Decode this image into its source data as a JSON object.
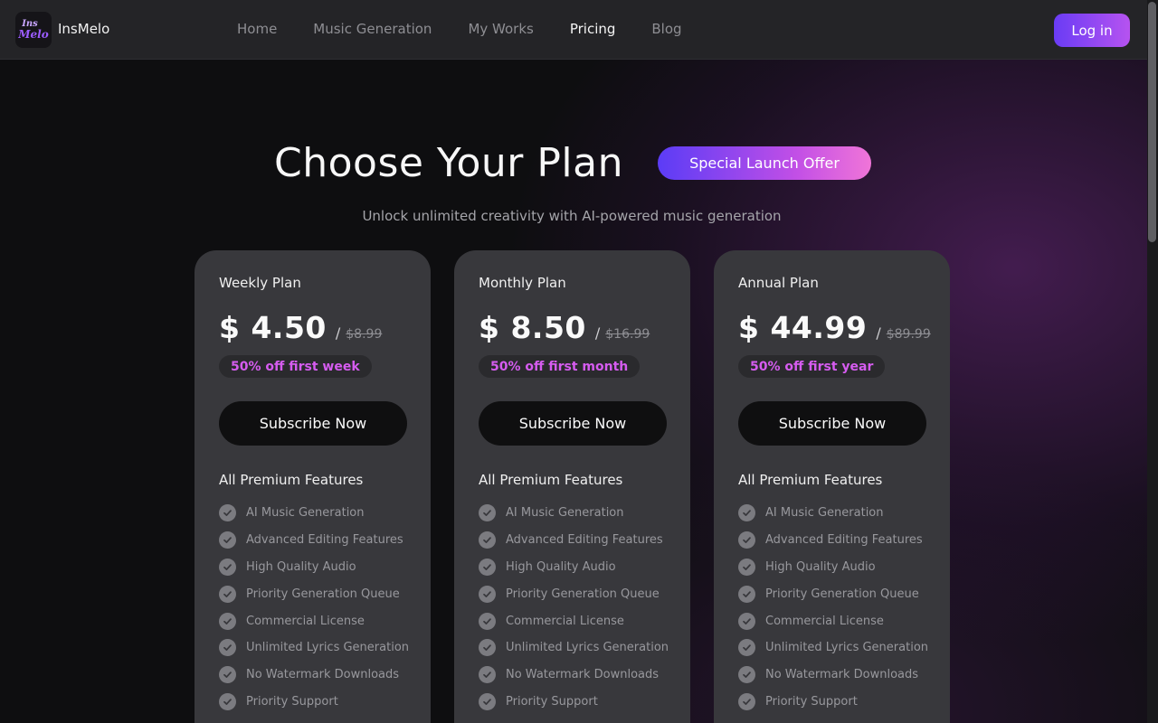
{
  "header": {
    "brand": "InsMelo",
    "logo": {
      "line1": "Ins",
      "line2": "Melo"
    },
    "nav": [
      {
        "label": "Home",
        "active": false
      },
      {
        "label": "Music Generation",
        "active": false
      },
      {
        "label": "My Works",
        "active": false
      },
      {
        "label": "Pricing",
        "active": true
      },
      {
        "label": "Blog",
        "active": false
      }
    ],
    "login_label": "Log in"
  },
  "hero": {
    "title": "Choose Your Plan",
    "badge": "Special Launch Offer",
    "subtitle": "Unlock unlimited creativity with AI-powered music generation"
  },
  "plans": [
    {
      "name": "Weekly Plan",
      "price": "$ 4.50",
      "slash": "/",
      "old_price": "$8.99",
      "discount": "50% off first week",
      "cta": "Subscribe Now",
      "features_title": "All Premium Features"
    },
    {
      "name": "Monthly Plan",
      "price": "$ 8.50",
      "slash": "/",
      "old_price": "$16.99",
      "discount": "50% off first month",
      "cta": "Subscribe Now",
      "features_title": "All Premium Features"
    },
    {
      "name": "Annual Plan",
      "price": "$ 44.99",
      "slash": "/",
      "old_price": "$89.99",
      "discount": "50% off first year",
      "cta": "Subscribe Now",
      "features_title": "All Premium Features"
    }
  ],
  "features": [
    "AI Music Generation",
    "Advanced Editing Features",
    "High Quality Audio",
    "Priority Generation Queue",
    "Commercial License",
    "Unlimited Lyrics Generation",
    "No Watermark Downloads",
    "Priority Support"
  ],
  "colors": {
    "accent_start": "#6a3cf5",
    "accent_end": "#b653f0",
    "discount_text": "#d65cf0",
    "card_bg": "#38383c"
  },
  "icons": {
    "feature_check": "check-circle-icon"
  }
}
